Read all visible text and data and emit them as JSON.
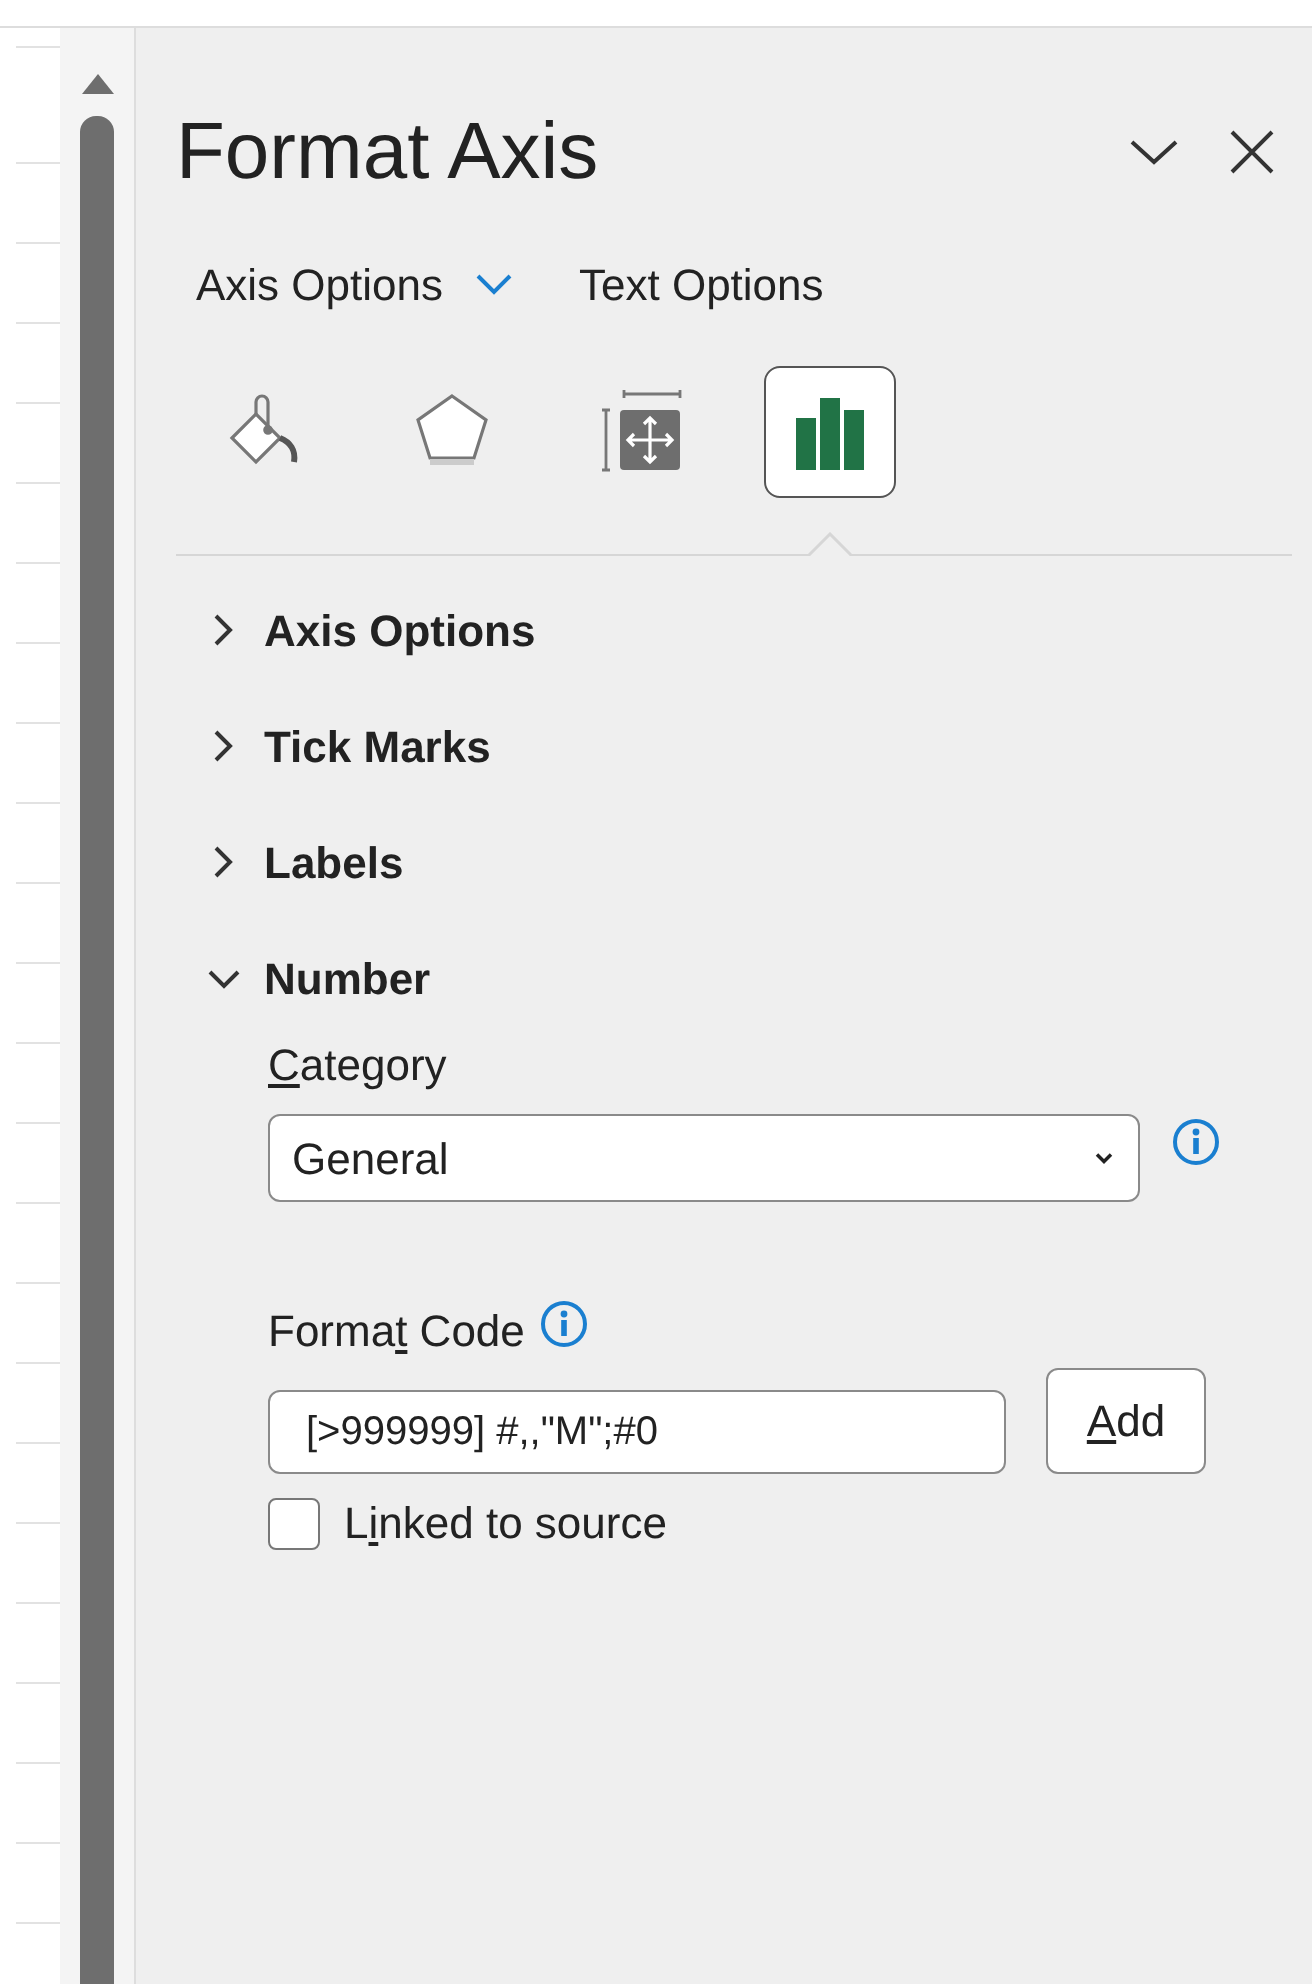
{
  "pane": {
    "title": "Format Axis"
  },
  "tabs": [
    {
      "label": "Axis Options",
      "dropdown": true
    },
    {
      "label": "Text Options",
      "dropdown": false
    }
  ],
  "icon_tabs": [
    {
      "kind": "fill",
      "selected": false
    },
    {
      "kind": "effects",
      "selected": false
    },
    {
      "kind": "size",
      "selected": false
    },
    {
      "kind": "axis",
      "selected": true
    }
  ],
  "sections": [
    {
      "title": "Axis Options",
      "expanded": false
    },
    {
      "title": "Tick Marks",
      "expanded": false
    },
    {
      "title": "Labels",
      "expanded": false
    },
    {
      "title": "Number",
      "expanded": true
    }
  ],
  "number": {
    "category_label": {
      "key": "C",
      "post": "ategory"
    },
    "category": "General",
    "format_code_label": {
      "pre": "Forma",
      "key": "t",
      "post": " Code"
    },
    "format_code": "[>999999] #,,\"M\";#0",
    "add_button": {
      "key": "A",
      "post": "dd"
    },
    "linked_label": {
      "pre": "L",
      "key": "i",
      "post": "nked to source"
    },
    "linked": false
  }
}
